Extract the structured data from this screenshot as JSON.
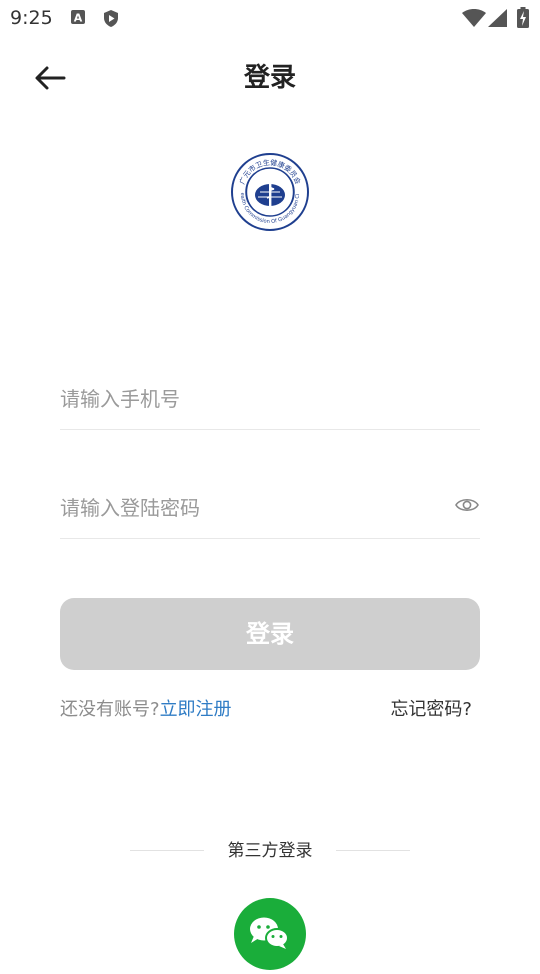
{
  "status_bar": {
    "time": "9:25",
    "icons": [
      "app-a-icon",
      "shield-play-icon",
      "wifi-icon",
      "cellular-signal-icon",
      "battery-charging-icon"
    ]
  },
  "header": {
    "title": "登录",
    "back_icon": "arrow-left-icon"
  },
  "logo": {
    "ring_text_top": "广元市卫生健康委员会",
    "ring_text_bottom": "Health Commission Of Guangyuan City",
    "color": "#1f3f8f"
  },
  "form": {
    "phone_placeholder": "请输入手机号",
    "phone_value": "",
    "password_placeholder": "请输入登陆密码",
    "password_value": "",
    "password_toggle_icon": "eye-icon",
    "login_label": "登录",
    "login_button_color": "#cfcfcf"
  },
  "links": {
    "no_account": "还没有账号?",
    "register": "立即注册",
    "forgot": "忘记密码?",
    "accent_color": "#2f7cc5"
  },
  "third_party": {
    "label": "第三方登录",
    "wechat_icon": "wechat-icon",
    "wechat_color": "#1aad3a"
  }
}
